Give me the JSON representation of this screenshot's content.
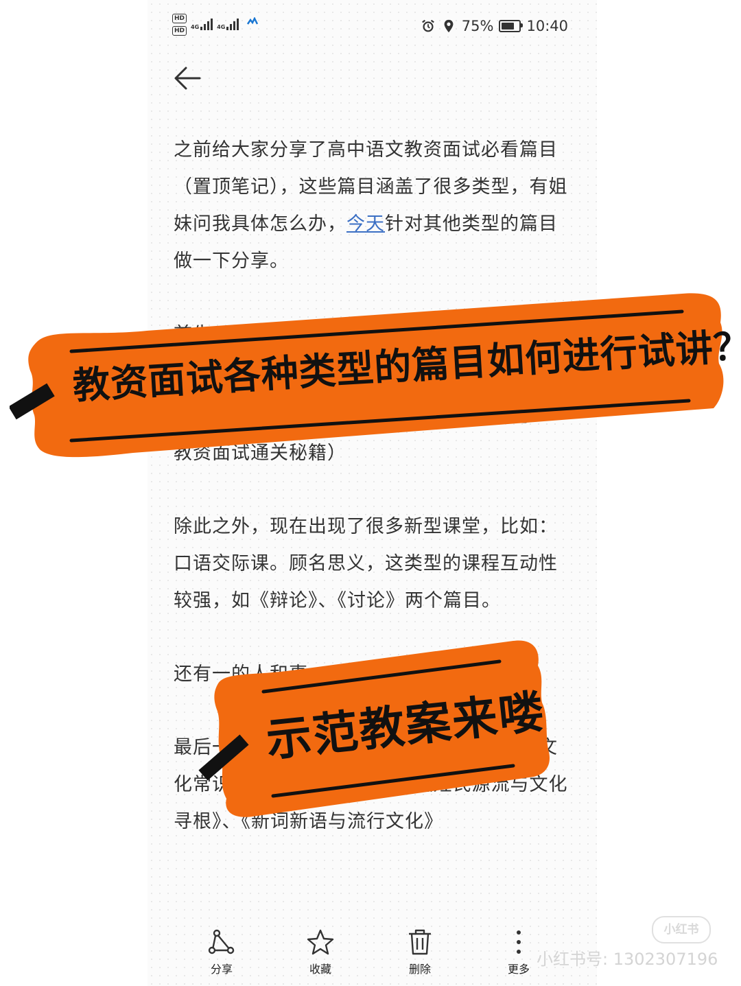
{
  "status_bar": {
    "hd_1": "HD",
    "hd_2": "HD",
    "net_1": "4G",
    "net_2": "4G",
    "battery": "75%",
    "battery_level": 0.75,
    "time": "10:40"
  },
  "article": {
    "paragraphs": [
      {
        "before_link": "之前给大家分享了高中语文教资面试必看篇目（置顶笔记），这些篇目涵盖了很多类型，有姐妹问我具体怎么办，",
        "link": "今天",
        "after_link": "针对其他类型的篇目做一下分享。"
      },
      {
        "text": "首先"
      },
      {
        "text": "的套路进行试讲就可以了。（详情可见笔记——教资面试通关秘籍）"
      },
      {
        "text": "除此之外，现在出现了很多新型课堂，比如：口语交际课。顾名思义，这类型的课程互动性较强，如《辩论》、《讨论》两个篇目。"
      },
      {
        "text": "还有一的人和事"
      },
      {
        "text": "最后一类是梳理探究课，这一类需要一定的文化常识积累，较难操作。如：《姓氏源流与文化寻根》、《新词新语与流行文化》"
      }
    ]
  },
  "banners": {
    "title": "教资面试各种类型的篇目如何进行试讲？",
    "subtitle": "示范教案来喽"
  },
  "toolbar": {
    "share": "分享",
    "favorite": "收藏",
    "delete": "删除",
    "more": "更多"
  },
  "watermark": {
    "badge": "小红书",
    "id": "小红书号: 1302307196"
  },
  "colors": {
    "banner_orange": "#f26a10",
    "link_blue": "#3b6fc4"
  }
}
